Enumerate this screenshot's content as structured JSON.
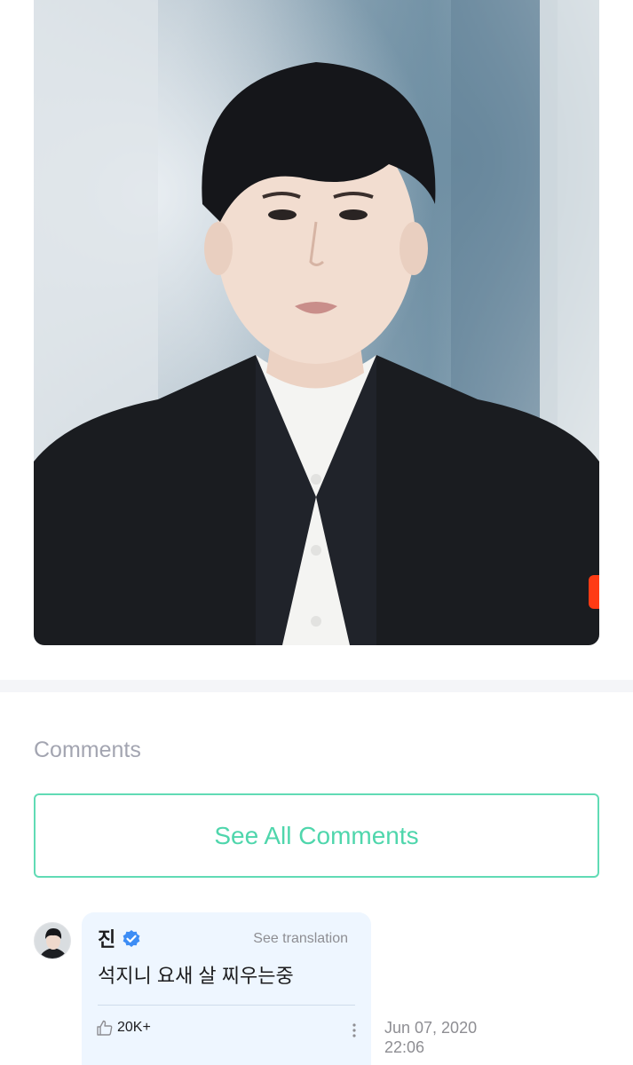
{
  "post": {
    "photo_icon": "portrait-photo",
    "accent_mark_color": "#ff3b14"
  },
  "comments_section": {
    "heading": "Comments",
    "see_all_label": "See All Comments",
    "accent_color": "#4fd6ac"
  },
  "comment": {
    "author": "진",
    "verified_icon": "verified-badge-icon",
    "see_translation_label": "See translation",
    "text": "석지니 요새 살 찌우는중",
    "likes": "20K+",
    "date": "Jun 07, 2020",
    "time": "22:06",
    "bubble_color": "#eef6ff"
  }
}
